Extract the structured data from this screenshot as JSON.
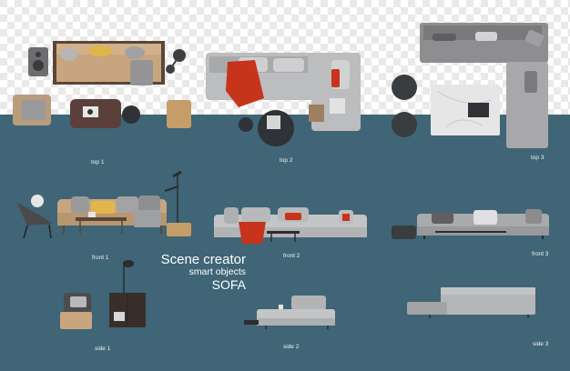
{
  "colors": {
    "background_teal": "#3f6576",
    "checker_light": "#ffffff",
    "checker_dark": "#e9e9e9",
    "sofa_grey": "#b4b4b6",
    "sofa_beige": "#c8a57f",
    "throw_red": "#c6341b"
  },
  "title": {
    "line1": "Scene creator",
    "line2": "smart objects",
    "line3": "SOFA"
  },
  "views": {
    "top1": "top 1",
    "top2": "top 2",
    "top3": "top 3",
    "front1": "front 1",
    "front2": "front 2",
    "front3": "front 3",
    "side1": "side 1",
    "side2": "side 2",
    "side3": "side 3"
  }
}
